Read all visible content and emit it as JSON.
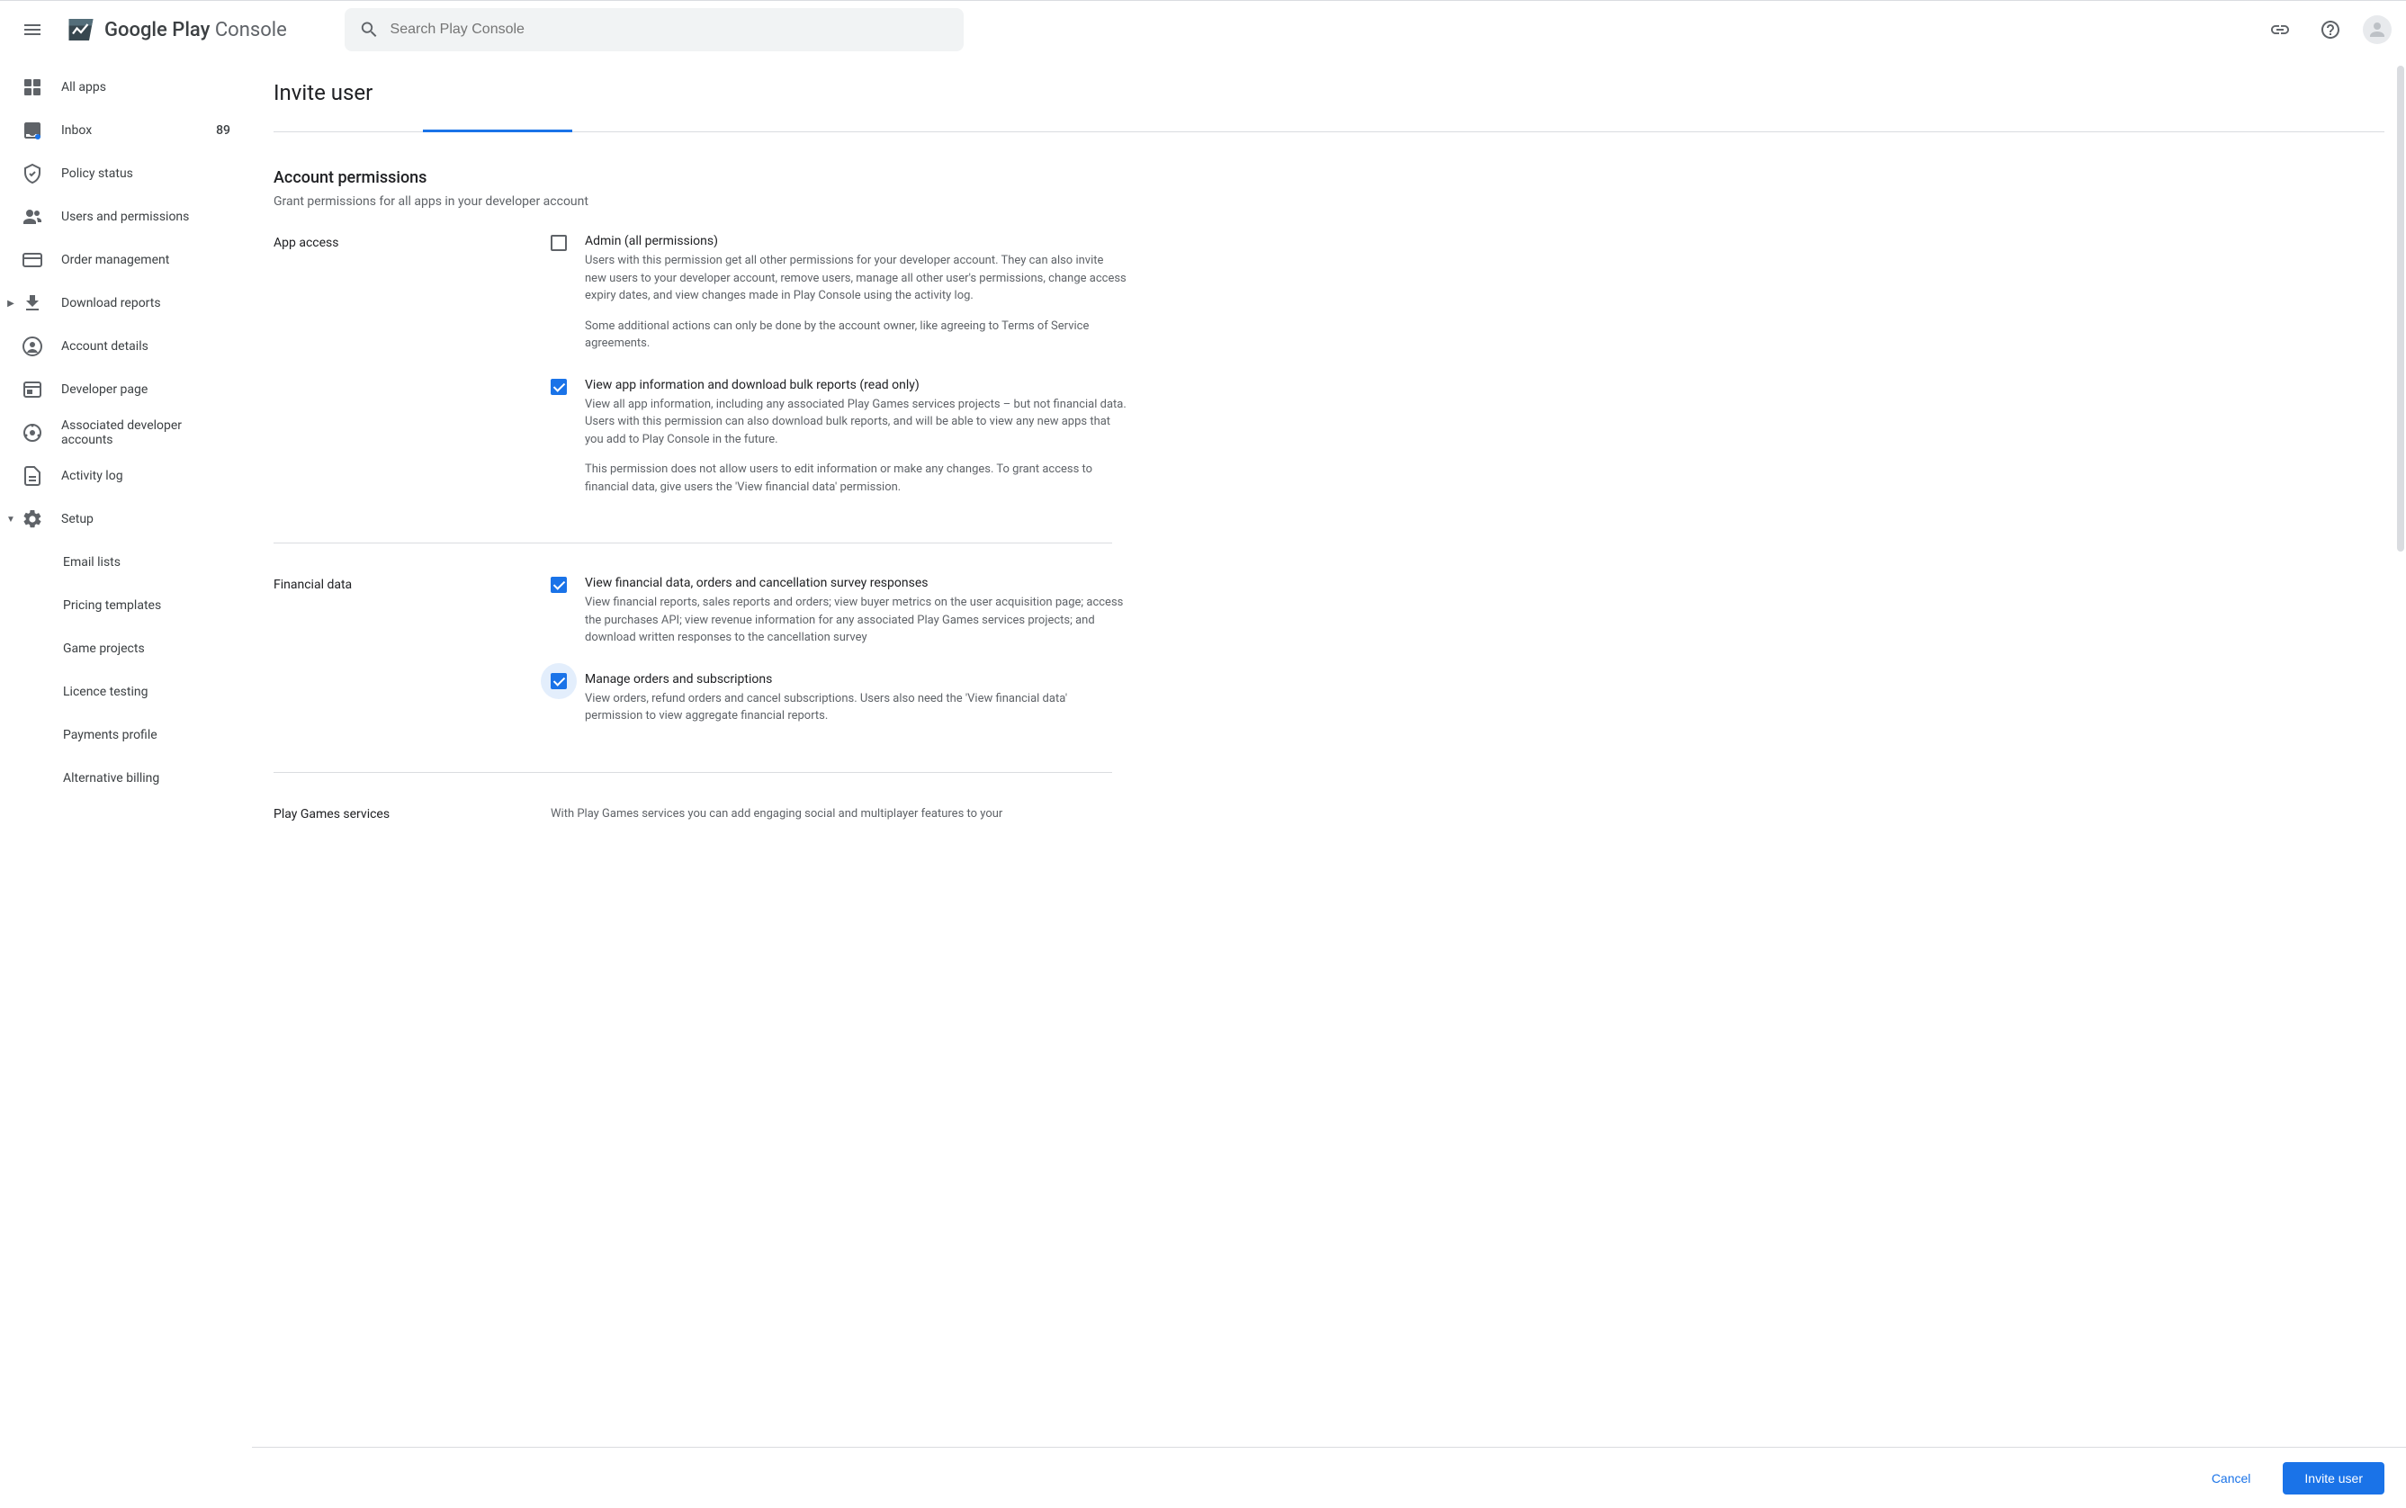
{
  "header": {
    "logo_text_a": "Google Play",
    "logo_text_b": " Console",
    "search_placeholder": "Search Play Console"
  },
  "sidebar": {
    "items": [
      {
        "label": "All apps",
        "icon": "apps"
      },
      {
        "label": "Inbox",
        "icon": "inbox",
        "badge": "89"
      },
      {
        "label": "Policy status",
        "icon": "shield"
      },
      {
        "label": "Users and permissions",
        "icon": "people"
      },
      {
        "label": "Order management",
        "icon": "card"
      },
      {
        "label": "Download reports",
        "icon": "download",
        "expandable": true
      },
      {
        "label": "Account details",
        "icon": "account"
      },
      {
        "label": "Developer page",
        "icon": "page"
      },
      {
        "label": "Associated developer accounts",
        "icon": "link"
      },
      {
        "label": "Activity log",
        "icon": "log"
      },
      {
        "label": "Setup",
        "icon": "gear",
        "expanded": true
      }
    ],
    "sub_items": [
      {
        "label": "Email lists"
      },
      {
        "label": "Pricing templates"
      },
      {
        "label": "Game projects"
      },
      {
        "label": "Licence testing"
      },
      {
        "label": "Payments profile"
      },
      {
        "label": "Alternative billing"
      }
    ]
  },
  "main": {
    "page_title": "Invite user",
    "section_title": "Account permissions",
    "section_sub": "Grant permissions for all apps in your developer account",
    "groups": [
      {
        "category": "App access",
        "items": [
          {
            "checked": false,
            "label": "Admin (all permissions)",
            "desc": [
              "Users with this permission get all other permissions for your developer account. They can also invite new users to your developer account, remove users, manage all other user's permissions, change access expiry dates, and view changes made in Play Console using the activity log.",
              "Some additional actions can only be done by the account owner, like agreeing to Terms of Service agreements."
            ]
          },
          {
            "checked": true,
            "label": "View app information and download bulk reports (read only)",
            "desc": [
              "View all app information, including any associated Play Games services projects – but not financial data. Users with this permission can also download bulk reports, and will be able to view any new apps that you add to Play Console in the future.",
              "This permission does not allow users to edit information or make any changes. To grant access to financial data, give users the 'View financial data' permission."
            ]
          }
        ]
      },
      {
        "category": "Financial data",
        "items": [
          {
            "checked": true,
            "label": "View financial data, orders and cancellation survey responses",
            "desc": [
              "View financial reports, sales reports and orders; view buyer metrics on the user acquisition page; access the purchases API; view revenue information for any associated Play Games services projects; and download written responses to the cancellation survey"
            ]
          },
          {
            "checked": true,
            "ripple": true,
            "label": "Manage orders and subscriptions",
            "desc": [
              "View orders, refund orders and cancel subscriptions. Users also need the 'View financial data' permission to view aggregate financial reports."
            ]
          }
        ]
      },
      {
        "category": "Play Games services",
        "intro": "With Play Games services you can add engaging social and multiplayer features to your"
      }
    ]
  },
  "footer": {
    "cancel": "Cancel",
    "invite": "Invite user"
  }
}
